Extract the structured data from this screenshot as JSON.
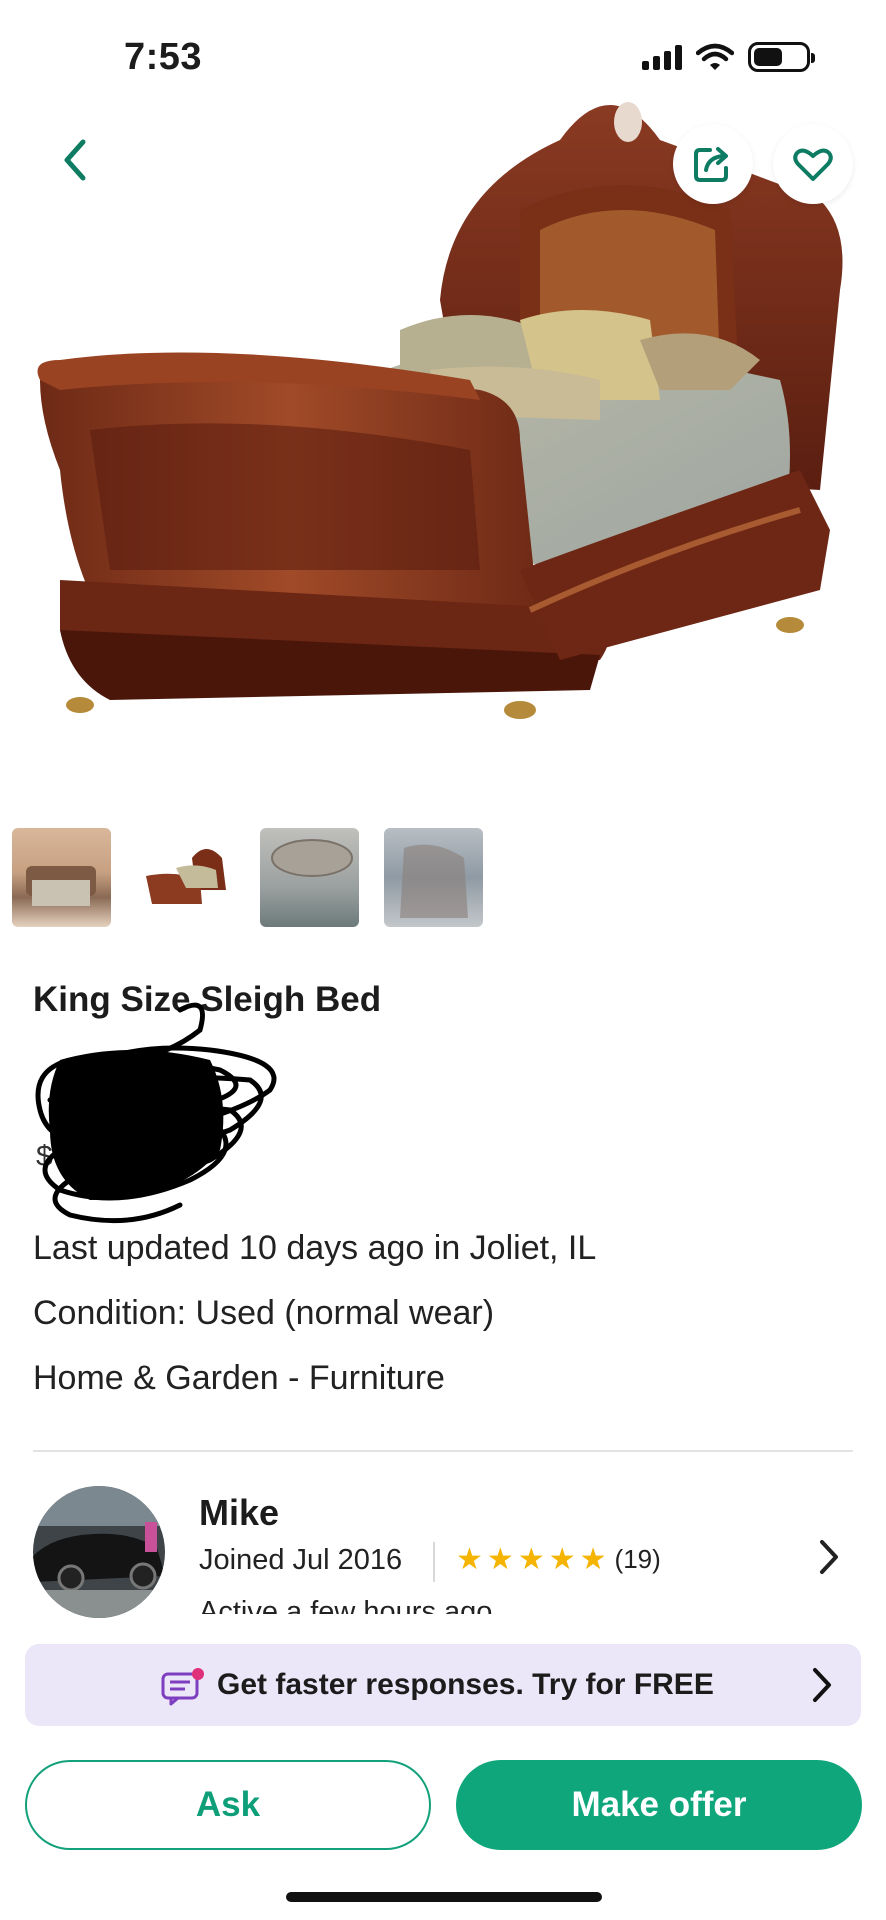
{
  "status_bar": {
    "time": "7:53",
    "icons": [
      "signal-icon",
      "wifi-icon",
      "battery-icon"
    ]
  },
  "top_actions": {
    "back_icon": "chevron-left-icon",
    "share_icon": "share-icon",
    "favorite_icon": "heart-icon"
  },
  "gallery": {
    "thumbnails": [
      "bedroom photo",
      "sleigh bed photo",
      "logo plate photo",
      "headboard detail photo"
    ]
  },
  "listing": {
    "title": "King Size Sleigh Bed",
    "price": "$",
    "last_updated": "Last updated 10 days ago in Joliet, IL",
    "condition": "Condition: Used (normal wear)",
    "category": "Home & Garden - Furniture"
  },
  "seller": {
    "name": "Mike",
    "joined": "Joined Jul 2016",
    "rating_stars": 5,
    "rating_count": "(19)",
    "activity": "Active a few hours ago"
  },
  "promo": {
    "text": "Get faster responses.  Try for FREE"
  },
  "actions": {
    "ask_label": "Ask",
    "offer_label": "Make offer"
  },
  "colors": {
    "accent": "#0fa67b",
    "accent_dark": "#0e7c63",
    "promo_bg": "#ebe7f8",
    "star": "#f5b400"
  }
}
